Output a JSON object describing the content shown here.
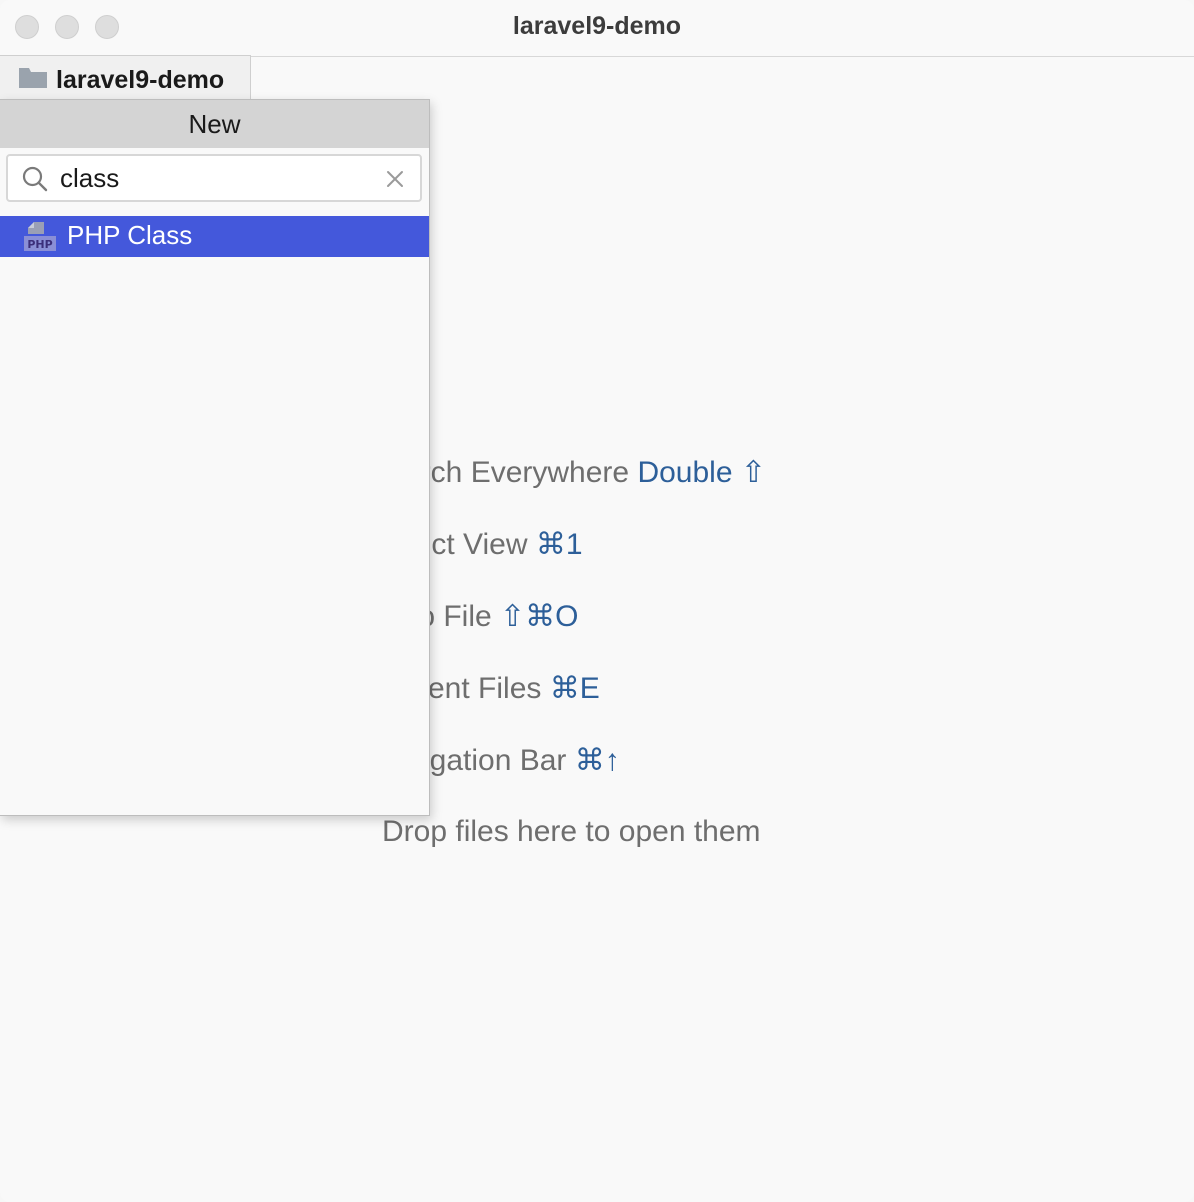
{
  "window": {
    "title": "laravel9-demo"
  },
  "project_tab": {
    "label": "laravel9-demo",
    "icon": "folder-icon"
  },
  "popup": {
    "title": "New",
    "search": {
      "value": "class",
      "icon": "search-icon",
      "clear_icon": "clear-icon"
    },
    "results": [
      {
        "label": "PHP Class",
        "icon": "php-icon",
        "selected": true
      }
    ],
    "selected_color": "#4458db"
  },
  "hints": [
    {
      "text": "arch Everywhere ",
      "shortcut": "Double ⇧"
    },
    {
      "text": "ject View ",
      "shortcut": "⌘1"
    },
    {
      "text": "to File ",
      "shortcut": "⇧⌘O"
    },
    {
      "text": "cent Files ",
      "shortcut": "⌘E"
    },
    {
      "text": "vigation Bar ",
      "shortcut": "⌘↑"
    },
    {
      "text": "Drop files here to open them",
      "shortcut": ""
    }
  ],
  "colors": {
    "hint_text": "#6e6e6e",
    "shortcut_text": "#2d5f99"
  }
}
